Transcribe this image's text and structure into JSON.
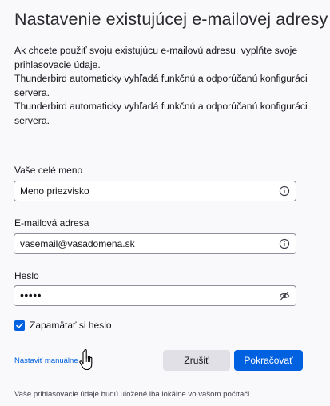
{
  "dialog": {
    "title": "Nastavenie existujúcej e-mailovej adresy",
    "description_lines": [
      "Ak chcete použiť svoju existujúcu e-mailovú adresu, vyplňte svoje",
      "prihlasovacie údaje.",
      "Thunderbird automaticky vyhľadá funkčnú a odporúčanú konfiguráci",
      "servera.",
      "Thunderbird automaticky vyhľadá funkčnú a odporúčanú konfiguráci",
      "servera."
    ]
  },
  "form": {
    "name": {
      "label": "Vaše celé meno",
      "value": "Meno priezvisko",
      "icon": "info-icon"
    },
    "email": {
      "label": "E-mailová adresa",
      "value": "vasemail@vasadomena.sk",
      "icon": "info-icon"
    },
    "password": {
      "label": "Heslo",
      "masked_value": "•••••",
      "icon": "eye-slash-icon"
    },
    "remember_password": {
      "label": "Zapamätať si heslo",
      "checked": true
    }
  },
  "actions": {
    "manual_link": "Nastaviť manuálne",
    "cancel": "Zrušiť",
    "continue": "Pokračovať"
  },
  "footer": {
    "note": "Vaše prihlasovacie údaje budú uložené iba lokálne vo vašom počítači."
  },
  "colors": {
    "accent": "#0061e0",
    "background": "#f9f9fb",
    "secondary_button": "#e0e0e6"
  }
}
